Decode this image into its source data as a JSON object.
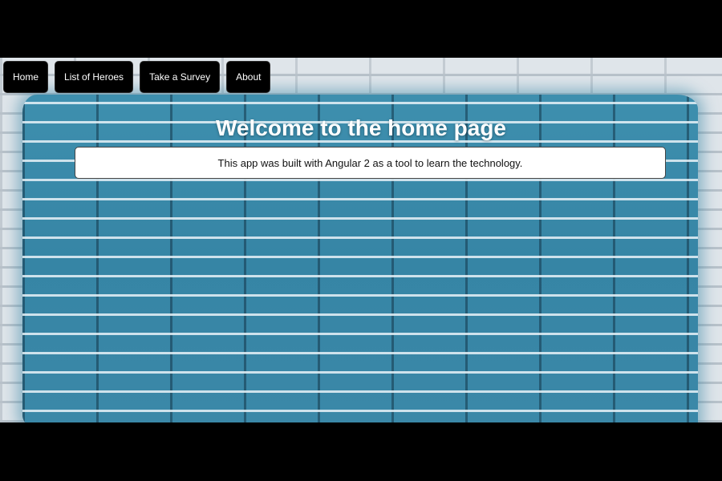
{
  "nav": {
    "items": [
      {
        "label": "Home"
      },
      {
        "label": "List of Heroes"
      },
      {
        "label": "Take a Survey"
      },
      {
        "label": "About"
      }
    ]
  },
  "main": {
    "title": "Welcome to the home page",
    "intro": "This app was built with Angular 2 as a tool to learn the technology."
  },
  "colors": {
    "letterbox": "#000000",
    "nav_button_bg": "#000000",
    "nav_button_text": "#ffffff",
    "paint_blue": "#3a87a6",
    "card_bg": "#ffffff"
  }
}
